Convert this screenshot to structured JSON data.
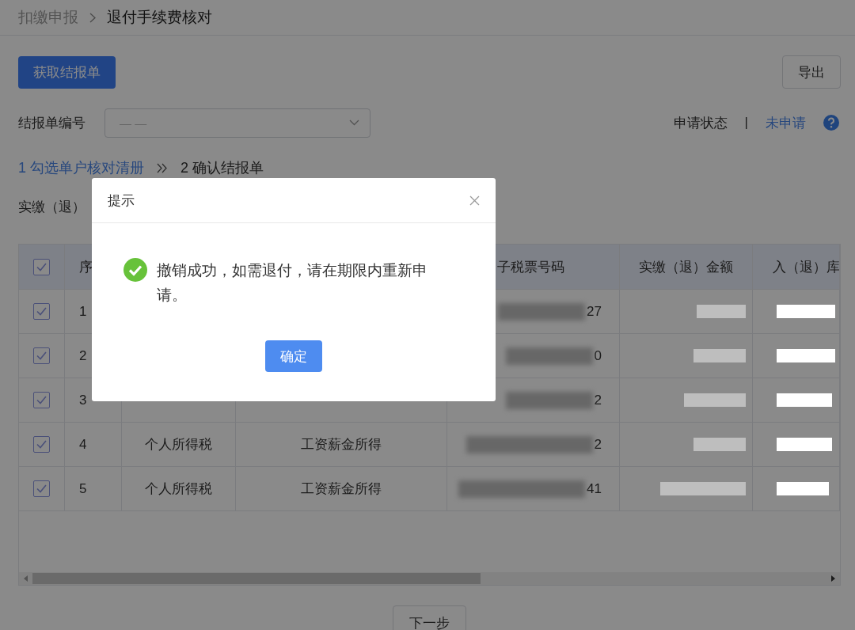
{
  "breadcrumb": [
    {
      "label": "扣缴申报",
      "selected": false
    },
    {
      "label": "退付手续费核对",
      "selected": true
    }
  ],
  "fetch_button": "获取结报单",
  "export_button": "导出",
  "filter": {
    "label": "结报单编号",
    "placeholder": "— —"
  },
  "status": {
    "label": "申请状态",
    "separator": "|",
    "value": "未申请"
  },
  "steps": [
    {
      "number": "1",
      "label": "勾选单户核对清册",
      "active": true
    },
    {
      "number": "2",
      "label": "确认结报单",
      "active": false
    }
  ],
  "amount_label": "实缴（退）",
  "table": {
    "all_checked": true,
    "columns": {
      "number": "序",
      "ticket": "子税票号码",
      "amount": "实缴（退）金额",
      "date": "入（退）库"
    },
    "rows": [
      {
        "checked": true,
        "number": "1",
        "ticket_tail": "27"
      },
      {
        "checked": true,
        "number": "2",
        "ticket_tail": "0"
      },
      {
        "checked": true,
        "number": "3",
        "ticket_tail": "2"
      },
      {
        "checked": true,
        "number": "4",
        "tax_type": "个人所得税",
        "item": "工资薪金所得",
        "ticket_tail": "2"
      },
      {
        "checked": true,
        "number": "5",
        "tax_type": "个人所得税",
        "item": "工资薪金所得",
        "ticket_tail": "41"
      }
    ]
  },
  "next_button": "下一步",
  "dialog": {
    "title": "提示",
    "message": "撤销成功，如需退付，请在期限内重新申请。",
    "confirm": "确定"
  }
}
